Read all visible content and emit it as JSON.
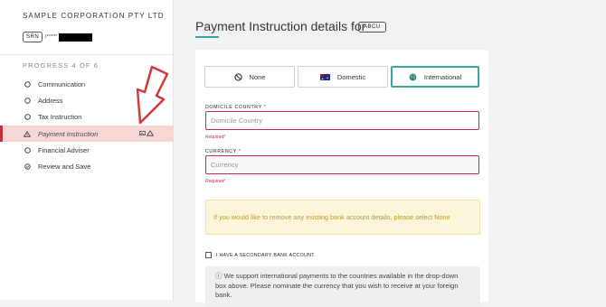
{
  "sidebar": {
    "company": "SAMPLE CORPORATION PTY LTD",
    "srn_label": "SRN",
    "srn_mask": "I******",
    "progress": "PROGRESS 4 OF 6",
    "items": [
      {
        "label": "Communication",
        "icon": "circle-icon"
      },
      {
        "label": "Address",
        "icon": "circle-icon"
      },
      {
        "label": "Tax Instruction",
        "icon": "circle-icon"
      },
      {
        "label": "Payment Instruction",
        "icon": "warning-icon"
      },
      {
        "label": "Financial Adviser",
        "icon": "circle-icon"
      },
      {
        "label": "Review and Save",
        "icon": "check-circle-icon"
      }
    ]
  },
  "main": {
    "title": "Payment Instruction details for",
    "badge": "ABCU",
    "tabs": [
      {
        "label": "None",
        "icon": "no-entry-icon"
      },
      {
        "label": "Domestic",
        "icon": "australia-flag-icon"
      },
      {
        "label": "International",
        "icon": "globe-icon"
      }
    ],
    "domicile_label": "DOMICILE COUNTRY",
    "domicile_placeholder": "Domicile Country",
    "currency_label": "CURRENCY",
    "currency_placeholder": "Currency",
    "required_star": "*",
    "required_text": "Required!",
    "notice": "If you would like to remove any existing bank account details, please select None",
    "secondary_checkbox": "I HAVE A SECONDARY BANK ACCOUNT.",
    "info_line1": "ⓘ We support international payments to the countries available in the drop-down",
    "info_line2": "box above. Please nominate the currency that you wish to receive at your foreign",
    "info_line3": "bank."
  },
  "colors": {
    "accent": "#3ba4a8",
    "error": "#c32f3d",
    "active_bg": "#f9d6d6",
    "notice_bg": "#fbf6d9",
    "notice_text": "#b69b25"
  }
}
